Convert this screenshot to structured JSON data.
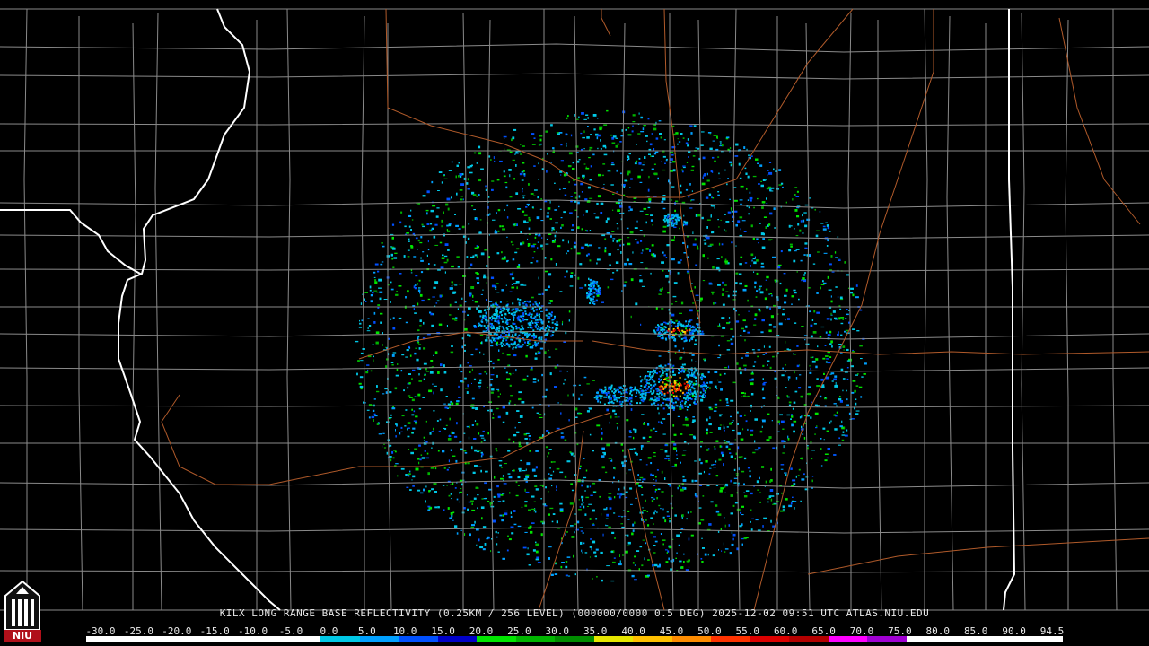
{
  "product": {
    "caption": "KILX LONG RANGE BASE REFLECTIVITY (0.25KM / 256 LEVEL) (000000/0000 0.5 DEG) 2025-12-02 09:51 UTC  ATLAS.NIU.EDU"
  },
  "logo": {
    "text": "NIU",
    "icon": "niu-tower-icon"
  },
  "colors": {
    "background": "#000000",
    "county_lines": "#8a8a8a",
    "state_lines": "#ffffff",
    "roads": "#b05a2a"
  },
  "legend": {
    "labels": [
      "-30.0",
      "-25.0",
      "-20.0",
      "-15.0",
      "-10.0",
      "-5.0",
      "0.0",
      "5.0",
      "10.0",
      "15.0",
      "20.0",
      "25.0",
      "30.0",
      "35.0",
      "40.0",
      "45.0",
      "50.0",
      "55.0",
      "60.0",
      "65.0",
      "70.0",
      "75.0",
      "80.0",
      "85.0",
      "90.0",
      "94.5"
    ],
    "colors": [
      "#ffffff",
      "#ffffff",
      "#ffffff",
      "#ffffff",
      "#ffffff",
      "#ffffff",
      "#00c8e6",
      "#00a0ff",
      "#0050ff",
      "#0000c8",
      "#00e600",
      "#00b400",
      "#008c00",
      "#e6e600",
      "#ffc000",
      "#ff8c00",
      "#ff3200",
      "#dc0000",
      "#b40000",
      "#ff00ff",
      "#a000d2",
      "#ffffff",
      "#ffffff",
      "#ffffff",
      "#ffffff"
    ]
  }
}
